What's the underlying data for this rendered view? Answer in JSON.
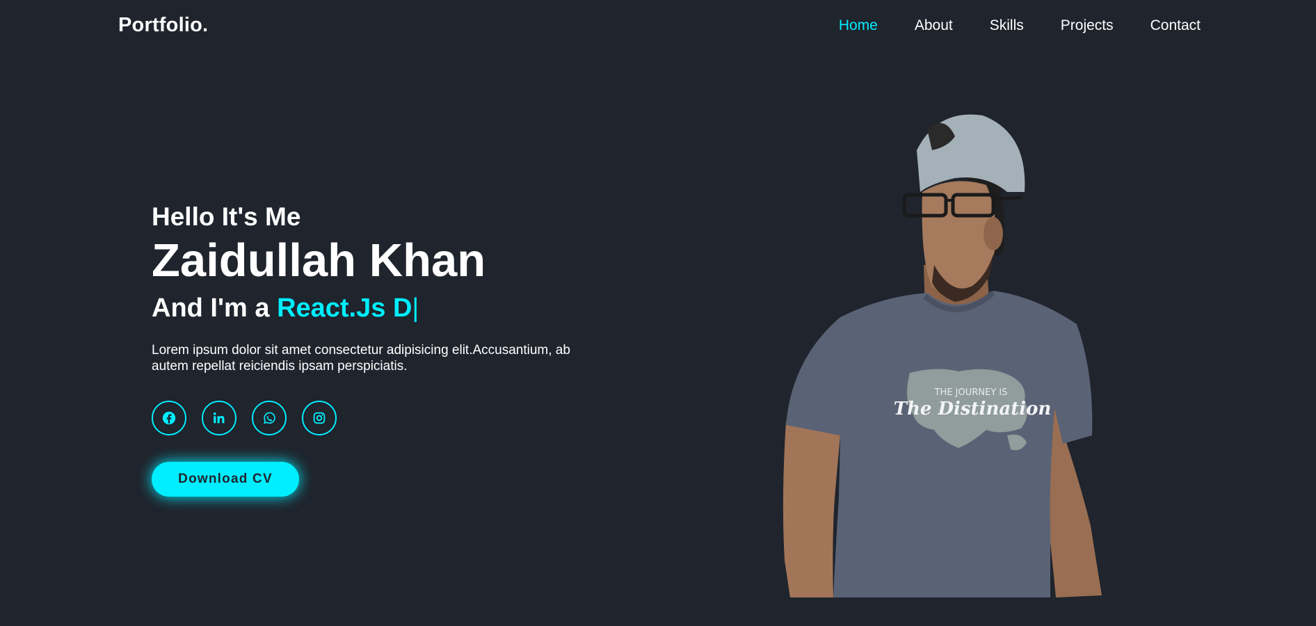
{
  "header": {
    "logo": "Portfolio.",
    "nav": [
      {
        "label": "Home",
        "active": true
      },
      {
        "label": "About",
        "active": false
      },
      {
        "label": "Skills",
        "active": false
      },
      {
        "label": "Projects",
        "active": false
      },
      {
        "label": "Contact",
        "active": false
      }
    ]
  },
  "hero": {
    "greeting": "Hello It's Me",
    "name": "Zaidullah Khan",
    "role_prefix": "And I'm a ",
    "role_typed": "React.Js D",
    "cursor": "|",
    "description": "Lorem ipsum dolor sit amet consectetur adipisicing elit.Accusantium, ab autem repellat reiciendis ipsam perspiciatis.",
    "socials": [
      "facebook-icon",
      "linkedin-icon",
      "whatsapp-icon",
      "instagram-icon"
    ],
    "cv_button": "Download CV",
    "shirt_text_top": "THE JOURNEY IS",
    "shirt_text_bottom": "The Distination"
  },
  "colors": {
    "background": "#1f242d",
    "accent": "#00eeff",
    "text": "#ffffff"
  }
}
